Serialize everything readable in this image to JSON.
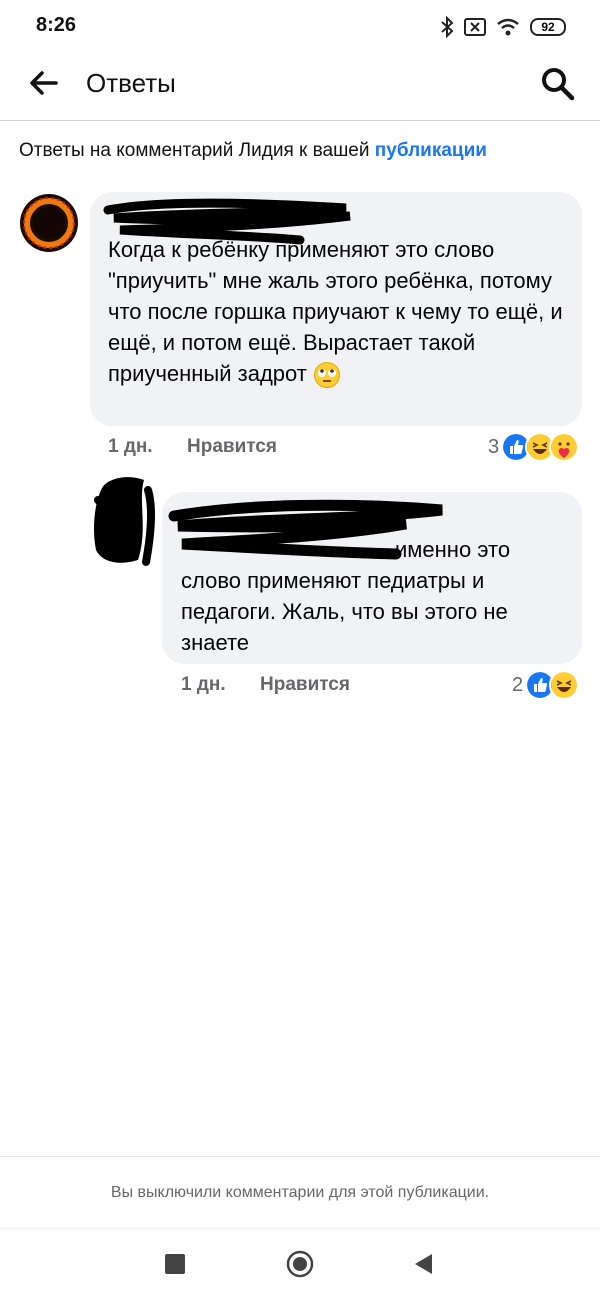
{
  "status_bar": {
    "time": "8:26",
    "battery": "92"
  },
  "header": {
    "title": "Ответы"
  },
  "context": {
    "text": "Ответы на комментарий Лидия к вашей ",
    "link": "публикации"
  },
  "comments": [
    {
      "text": "Когда к ребёнку применяют  это слово \"приучить\" мне жаль этого ребёнка, потому что после горшка приучают к чему то ещё, и ещё, и потом ещё. Вырастает такой приученный задрот",
      "time": "1 дн.",
      "like_label": "Нравится",
      "reactions_count": "3"
    },
    {
      "text_first": "именно это",
      "text_rest": "слово применяют педиатры и педагоги. Жаль, что вы этого не знаете",
      "time": "1 дн.",
      "like_label": "Нравится",
      "reactions_count": "2"
    }
  ],
  "footer": {
    "notice": "Вы выключили комментарии для этой публикации."
  },
  "colors": {
    "accent": "#1877f2",
    "bubble": "#f0f2f5",
    "meta": "#65676b"
  },
  "icons": [
    "back-arrow-icon",
    "search-icon",
    "like-reaction-icon",
    "haha-reaction-icon",
    "care-reaction-icon",
    "rolling-eyes-emoji"
  ]
}
